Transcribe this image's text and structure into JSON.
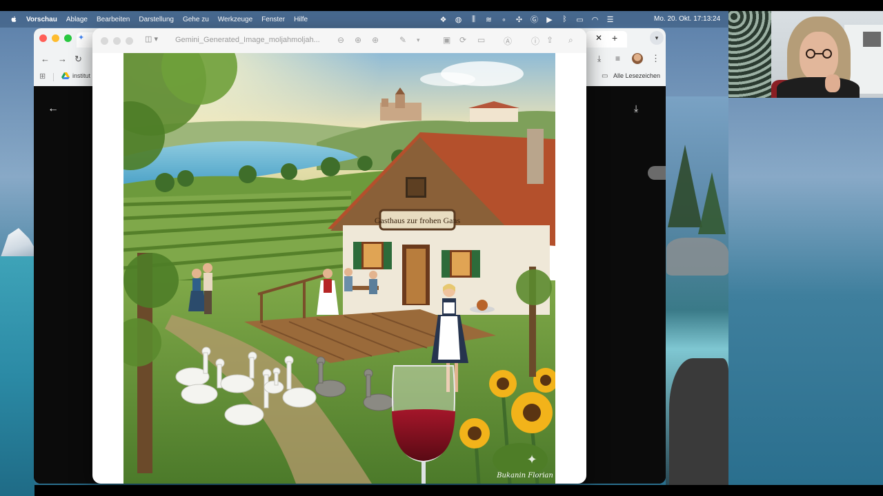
{
  "menubar": {
    "app_name": "Vorschau",
    "items": [
      "Ablage",
      "Bearbeiten",
      "Darstellung",
      "Gehe zu",
      "Werkzeuge",
      "Fenster",
      "Hilfe"
    ],
    "status_icons": [
      "dropbox-icon",
      "creative-cloud-icon",
      "audio-meter-icon",
      "audio-waves-icon",
      "dot-icon",
      "fan-icon",
      "grammarly-icon",
      "play-icon",
      "bluetooth-icon",
      "battery-icon",
      "wifi-icon",
      "control-center-icon"
    ],
    "clock": "Mo. 20. Okt.  17:13:24"
  },
  "browser": {
    "bookmark_label": "institut",
    "all_bookmarks_label": "Alle Lesezeichen",
    "close_tab_glyph": "✕",
    "new_tab_glyph": "+"
  },
  "preview": {
    "title": "Gemini_Generated_Image_moljahmoljah...",
    "image": {
      "sign_text": "Gasthaus zur frohen Gans",
      "signature": "Bukanin Florian"
    }
  },
  "colors": {
    "menubar_bg": "#375578",
    "preview_toolbar_bg": "#f6f6f6",
    "browser_chrome_bg": "#f1f3f4",
    "wine": "#7a0f1c"
  }
}
